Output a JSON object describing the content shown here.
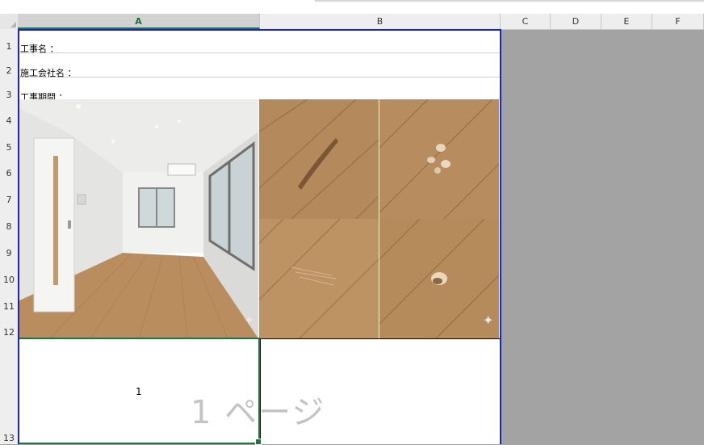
{
  "columns": [
    "A",
    "B",
    "C",
    "D",
    "E",
    "F"
  ],
  "selected_column": "A",
  "rows": [
    "1",
    "2",
    "3",
    "4",
    "5",
    "6",
    "7",
    "8",
    "9",
    "10",
    "11",
    "12",
    "13"
  ],
  "cells": {
    "a1": "工事名 ：",
    "a2": "施工会社名 ：",
    "a3": "工事期間 ：",
    "a13": "1"
  },
  "page_break_watermark": "1 ページ",
  "images": {
    "room_photo": "room-interior",
    "floor_photos": [
      "floor-gouge",
      "floor-chips",
      "floor-scratches",
      "floor-dent"
    ]
  },
  "colors": {
    "page_border": "#1a22c8",
    "selection": "#217346",
    "outside_print_area": "#a3a3a3"
  }
}
